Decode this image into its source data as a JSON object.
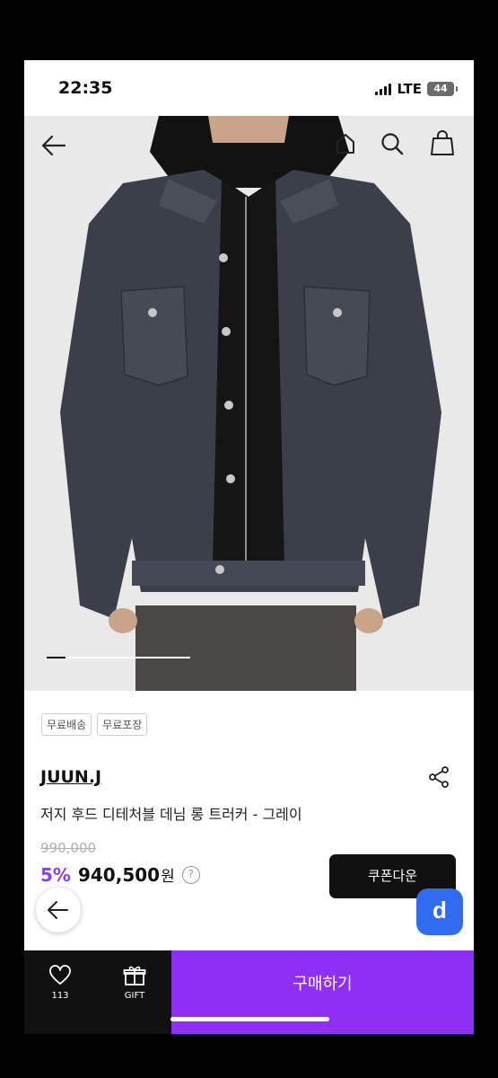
{
  "status_bar": {
    "time": "22:35",
    "network": "LTE",
    "battery": "44"
  },
  "gallery": {
    "progress_fraction": 0.13
  },
  "badges": [
    "무료배송",
    "무료포장"
  ],
  "product": {
    "brand": "JUUN.J",
    "name": "저지 후드 디테처블 데님 롱 트러커 - 그레이",
    "original_price": "990,000",
    "discount": "5%",
    "price": "940,500",
    "currency": "원",
    "help": "?"
  },
  "buttons": {
    "coupon": "쿠폰다운",
    "buy": "구매하기",
    "floating_app": "d"
  },
  "bottom_bar": {
    "like_count": "113",
    "gift_label": "GIFT"
  },
  "icons": [
    "back-arrow-icon",
    "home-icon",
    "search-icon",
    "bag-icon",
    "share-icon",
    "heart-icon",
    "gift-icon"
  ],
  "colors": {
    "accent": "#8f2ff5",
    "discount": "#8b3dff",
    "app_button": "#2f6cf0",
    "dark": "#111111"
  }
}
